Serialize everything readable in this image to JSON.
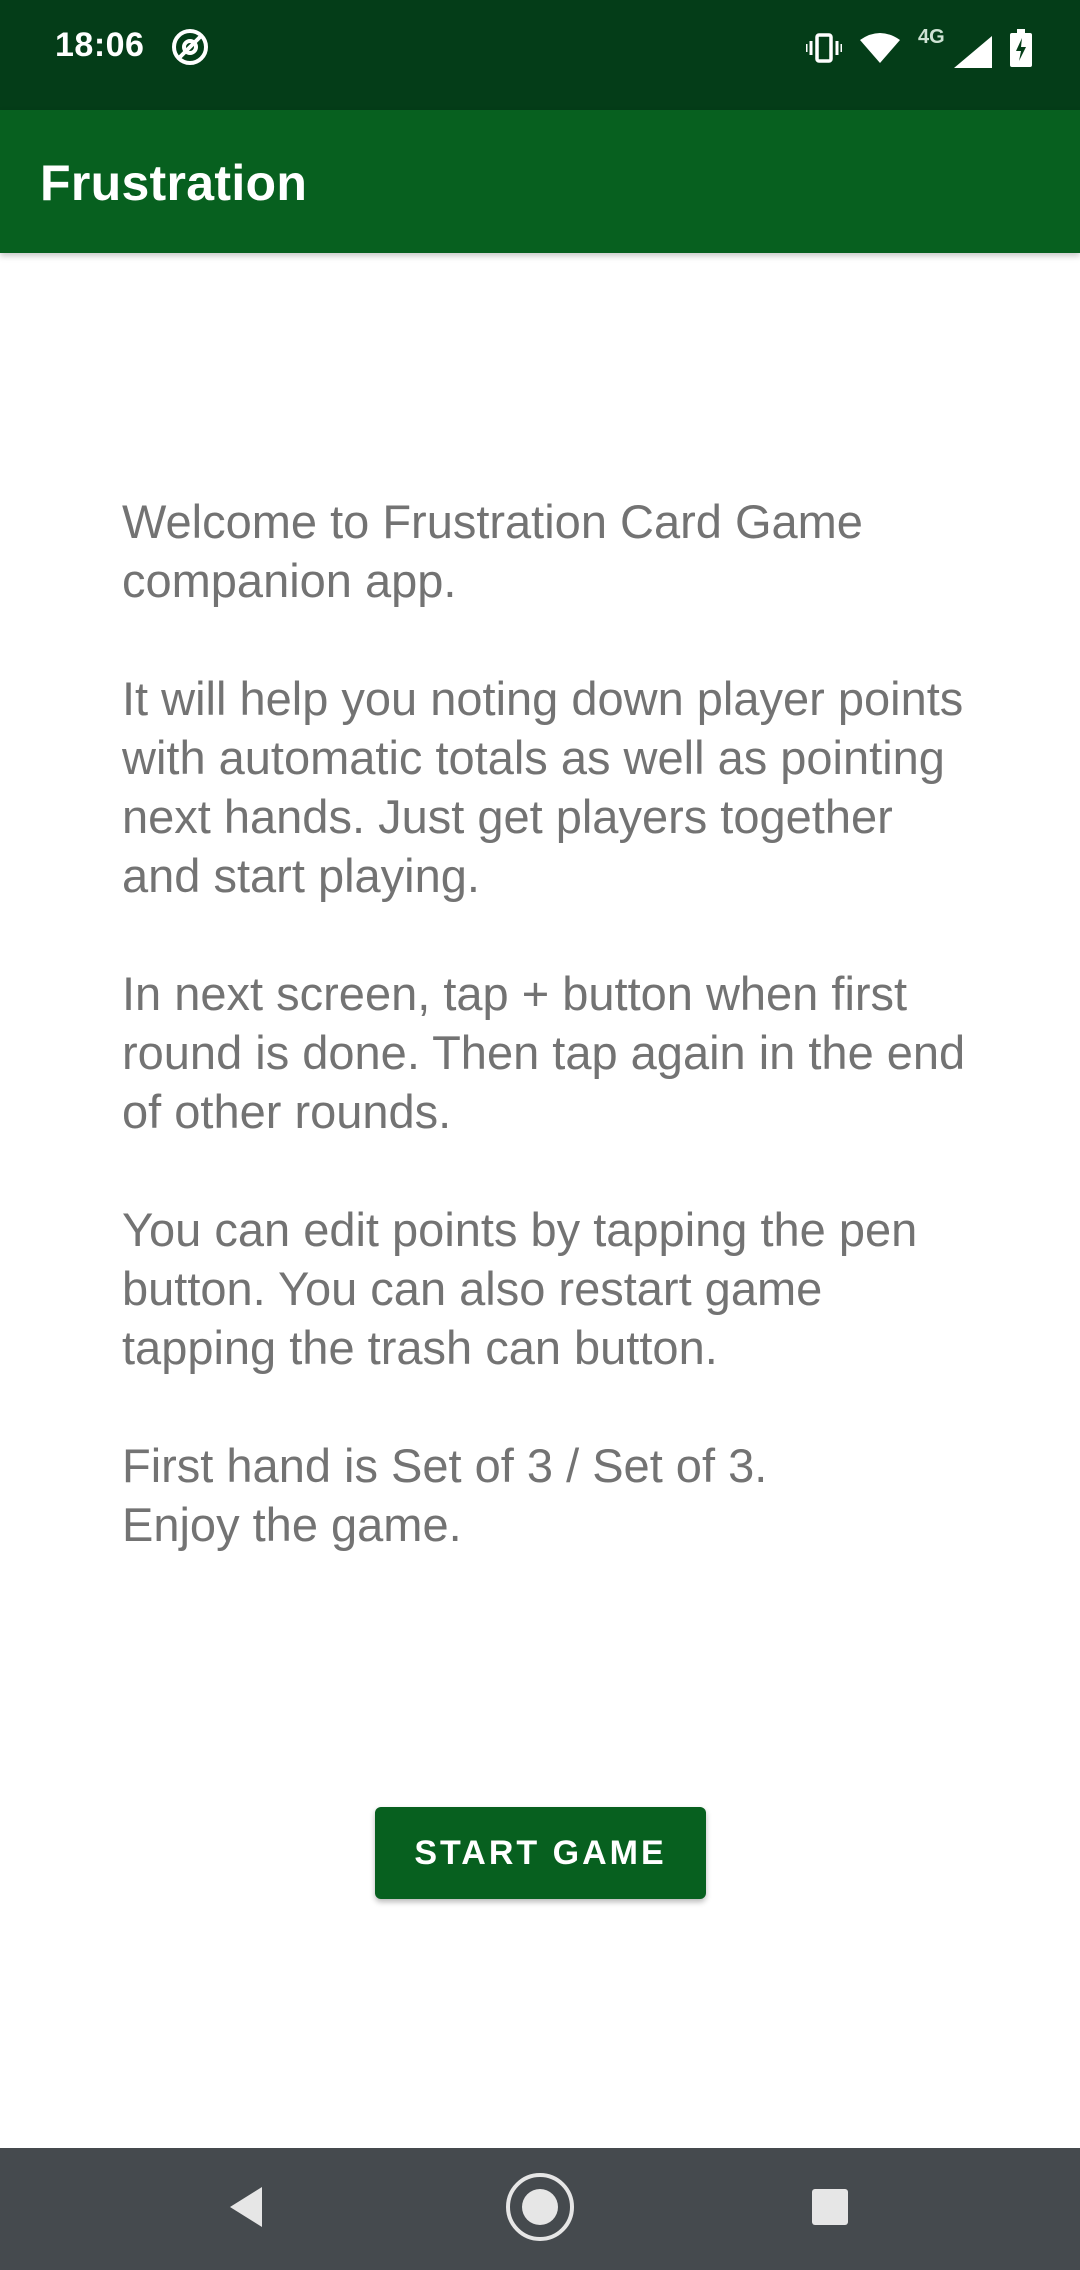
{
  "status_bar": {
    "time": "18:06",
    "network_label": "4G",
    "icons": [
      "at-sign-icon",
      "vibrate-icon",
      "wifi-icon",
      "cell-signal-icon",
      "battery-charging-icon"
    ]
  },
  "app_bar": {
    "title": "Frustration"
  },
  "intro": {
    "paragraphs": [
      "Welcome to Frustration Card Game companion app.",
      "It will help you noting down player points with automatic totals as well as pointing next hands. Just get players together and start playing.",
      "In next screen, tap + button when first round is done. Then tap again in the end of other rounds.",
      "You can edit points by tapping the pen button. You can also restart game tapping the trash can button.",
      "First hand is Set of 3 / Set of 3.\nEnjoy the game."
    ]
  },
  "actions": {
    "start_label": "START GAME"
  },
  "nav_bar": {
    "buttons": [
      "back-icon",
      "home-icon",
      "recents-icon"
    ]
  },
  "colors": {
    "status_bar": "#043d18",
    "app_bar": "#07601f",
    "button": "#07601f",
    "body_text": "#737373",
    "nav_bar": "#454a4e"
  }
}
